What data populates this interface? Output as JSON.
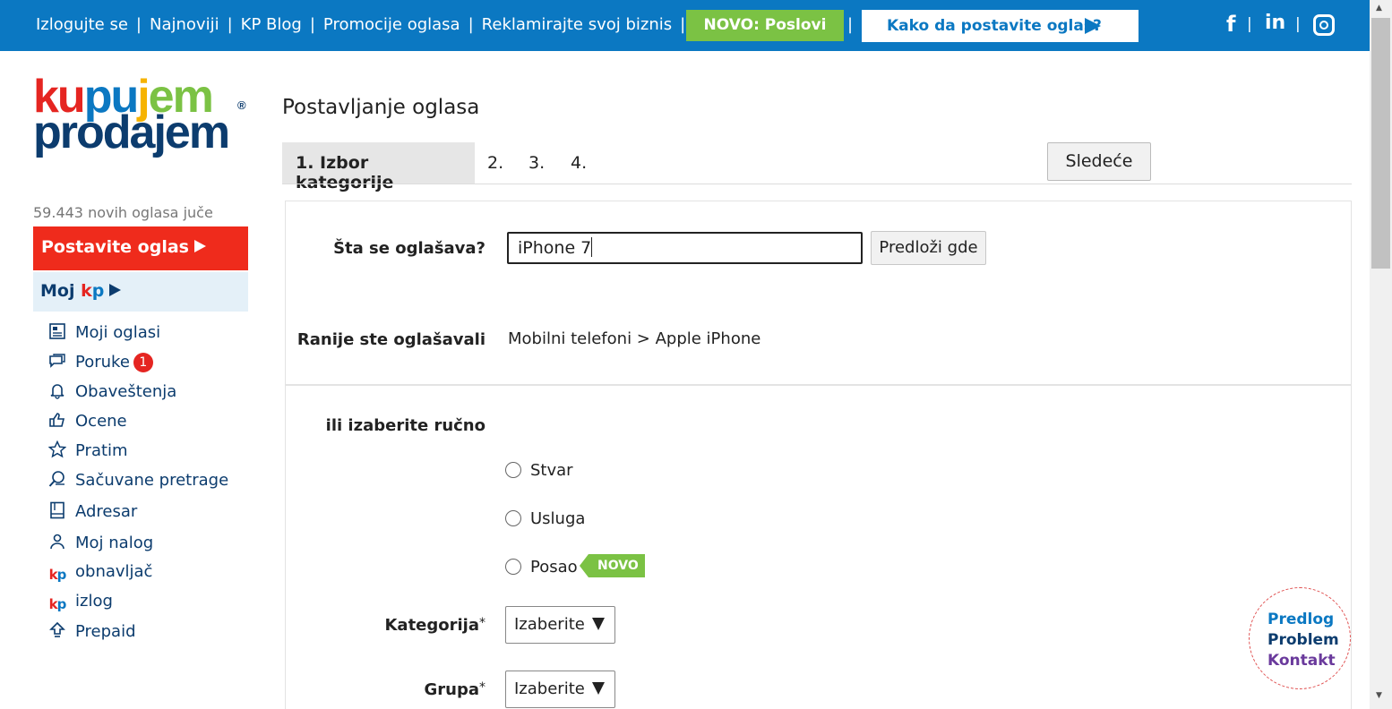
{
  "topbar": {
    "links": [
      "Izlogujte se",
      "Najnoviji",
      "KP Blog",
      "Promocije oglasa",
      "Reklamirajte svoj biznis"
    ],
    "novo_button": "NOVO: Poslovi",
    "how_to_button": "Kako da postavite oglas?",
    "social": [
      "facebook-icon",
      "linkedin-icon",
      "instagram-icon"
    ],
    "colors": {
      "bar": "#0b78c2",
      "novo": "#7bc244"
    }
  },
  "logo": {
    "line1": "kupujem",
    "line2": "prodajem",
    "mark": "®"
  },
  "sidebar": {
    "new_ads_text": "59.443 novih oglasa juče",
    "post_ad_label": "Postavite oglas",
    "moj_kp_label": "Moj",
    "moj_kp_k": "k",
    "moj_kp_p": "p",
    "items": [
      {
        "label": "Moji oglasi",
        "icon": "list-icon"
      },
      {
        "label": "Poruke",
        "icon": "chat-icon",
        "badge": "1"
      },
      {
        "label": "Obaveštenja",
        "icon": "bell-icon"
      },
      {
        "label": "Ocene",
        "icon": "thumbs-up-icon"
      },
      {
        "label": "Pratim",
        "icon": "star-icon"
      },
      {
        "label": "Sačuvane pretrage",
        "icon": "search-bell-icon"
      },
      {
        "label": "Adresar",
        "icon": "address-book-icon"
      },
      {
        "label": "Moj nalog",
        "icon": "user-icon"
      },
      {
        "label": "obnavljač",
        "icon": "kp-logo-icon"
      },
      {
        "label": "izlog",
        "icon": "kp-logo-icon"
      },
      {
        "label": "Prepaid",
        "icon": "upload-arrow-icon"
      }
    ],
    "colors": {
      "post_ad": "#ef2b1c",
      "moj_kp_bg": "#e4f0f8"
    }
  },
  "main": {
    "title": "Postavljanje oglasa",
    "steps": {
      "active": "1. Izbor kategorije",
      "rest": [
        "2.",
        "3.",
        "4."
      ]
    },
    "next_button": "Sledeće",
    "form": {
      "what_label": "Šta se oglašava?",
      "what_value": "iPhone 7",
      "suggest_button": "Predloži gde",
      "previous_label": "Ranije ste oglašavali",
      "previous_value": "Mobilni telefoni > Apple iPhone",
      "manual_label": "ili izaberite ručno",
      "radios": [
        {
          "label": "Stvar"
        },
        {
          "label": "Usluga"
        },
        {
          "label": "Posao",
          "tag": "NOVO"
        }
      ],
      "category_label": "Kategorija",
      "category_value": "Izaberite",
      "group_label": "Grupa",
      "group_value": "Izaberite",
      "required_mark": "*"
    }
  },
  "feedback": {
    "line1": "Predlog",
    "line2": "Problem",
    "line3": "Kontakt"
  }
}
